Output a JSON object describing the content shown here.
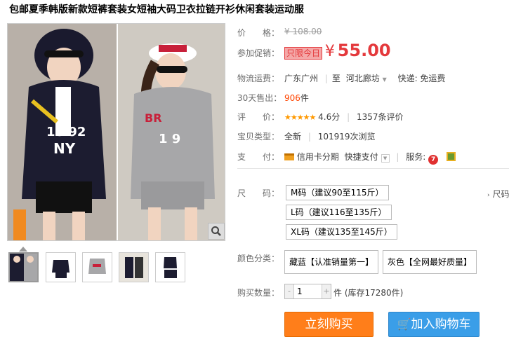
{
  "title": "包邮夏季韩版新款短裤套装女短袖大码卫衣拉链开衫休闲套装运动服",
  "price": {
    "label": "价　　格：",
    "value": "¥ 108.00"
  },
  "promo": {
    "label": "参加促销：",
    "badge": "只限今日",
    "yen": "¥",
    "value": "55.00"
  },
  "shipping": {
    "label": "物流运费：",
    "from": "广东广州",
    "sep": "至",
    "to": "河北廊坊",
    "method": "快递: 免运费"
  },
  "sold": {
    "label": "30天售出：",
    "count": "906",
    "unit": "件"
  },
  "rating": {
    "label": "评　　价：",
    "stars": "★★★★★",
    "score": "4.6分",
    "reviews": "1357条评价"
  },
  "type": {
    "label": "宝贝类型：",
    "value": "全新",
    "views": "101919次浏览"
  },
  "payment": {
    "label": "支　　付：",
    "card": "信用卡分期",
    "quick": "快捷支付",
    "service_label": "服务:"
  },
  "size": {
    "label": "尺　　码：",
    "options": [
      "M码（建议90至115斤）",
      "L码（建议116至135斤）",
      "XL码（建议135至145斤）"
    ],
    "side_link": "尺码"
  },
  "color": {
    "label": "颜色分类：",
    "options": [
      "藏蓝【认准销量第一】",
      "灰色【全网最好质量】"
    ]
  },
  "quantity": {
    "label": "购买数量：",
    "value": "1",
    "minus": "-",
    "plus": "+",
    "stock": "件 (库存17280件)"
  },
  "buttons": {
    "buy": "立刻购买",
    "cart": "加入购物车"
  },
  "colors": {
    "accent": "#e4393c",
    "buy": "#ff7e1a",
    "cart": "#3a9ee8"
  }
}
